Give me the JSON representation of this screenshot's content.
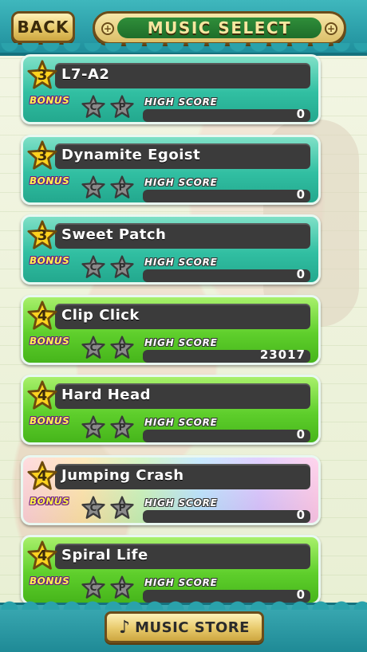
{
  "header": {
    "back_label": "BACK",
    "title": "MUSIC SELECT"
  },
  "labels": {
    "bonus": "BONUS",
    "high_score": "HIGH SCORE"
  },
  "bonus_marks": [
    "C",
    "P"
  ],
  "songs": [
    {
      "level": "3",
      "title": "L7-A2",
      "high_score": "0",
      "style": "teal"
    },
    {
      "level": "3",
      "title": "Dynamite Egoist",
      "high_score": "0",
      "style": "teal"
    },
    {
      "level": "3",
      "title": "Sweet Patch",
      "high_score": "0",
      "style": "teal"
    },
    {
      "level": "4",
      "title": "Clip Click",
      "high_score": "23017",
      "style": "green"
    },
    {
      "level": "4",
      "title": "Hard Head",
      "high_score": "0",
      "style": "green"
    },
    {
      "level": "4",
      "title": "Jumping Crash",
      "high_score": "0",
      "style": "rainbow"
    },
    {
      "level": "4",
      "title": "Spiral Life",
      "high_score": "0",
      "style": "green"
    }
  ],
  "footer": {
    "store_label": "MUSIC STORE",
    "note_icon": "♪"
  },
  "colors": {
    "header_bg": "#2aa2ab",
    "button_gold": "#e7c96a",
    "card_teal": "#31bfa2",
    "card_green": "#5fcf2c"
  }
}
